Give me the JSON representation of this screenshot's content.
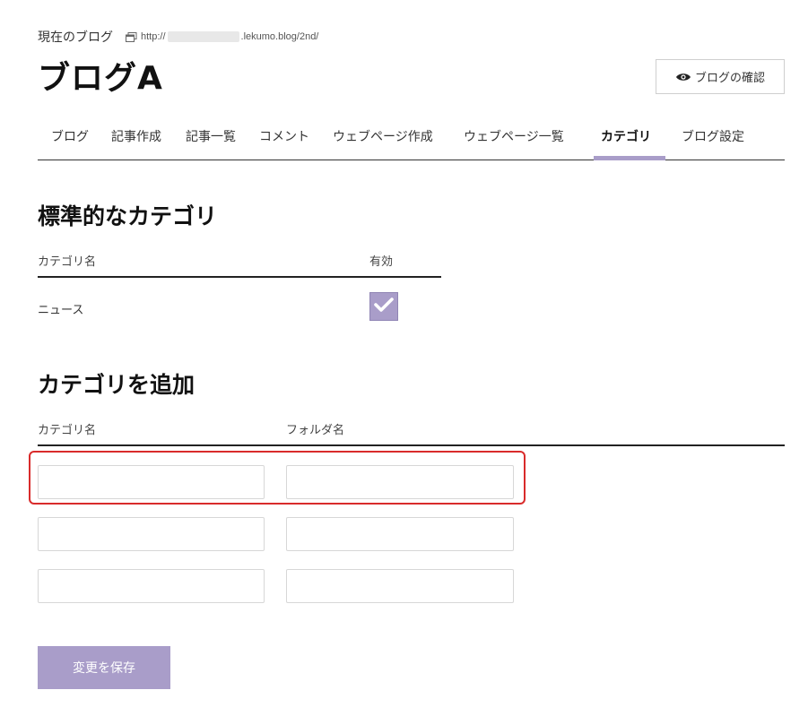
{
  "header": {
    "current_blog_label": "現在のブログ",
    "url_prefix": "http://",
    "url_suffix": ".lekumo.blog/2nd/",
    "blog_title": "ブログA",
    "view_blog_label": "ブログの確認"
  },
  "tabs": [
    {
      "label": "ブログ"
    },
    {
      "label": "記事作成"
    },
    {
      "label": "記事一覧"
    },
    {
      "label": "コメント"
    },
    {
      "label": "ウェブページ作成"
    },
    {
      "label": "ウェブページ一覧"
    },
    {
      "label": "カテゴリ",
      "active": true
    },
    {
      "label": "ブログ設定"
    }
  ],
  "standard_categories": {
    "heading": "標準的なカテゴリ",
    "col_name": "カテゴリ名",
    "col_enabled": "有効",
    "rows": [
      {
        "name": "ニュース",
        "enabled": true
      }
    ]
  },
  "add_category": {
    "heading": "カテゴリを追加",
    "col_name": "カテゴリ名",
    "col_folder": "フォルダ名",
    "rows": [
      {
        "name": "",
        "folder": ""
      },
      {
        "name": "",
        "folder": ""
      },
      {
        "name": "",
        "folder": ""
      }
    ]
  },
  "save_label": "変更を保存",
  "colors": {
    "accent": "#a99dc9",
    "highlight": "#d92b2b"
  }
}
